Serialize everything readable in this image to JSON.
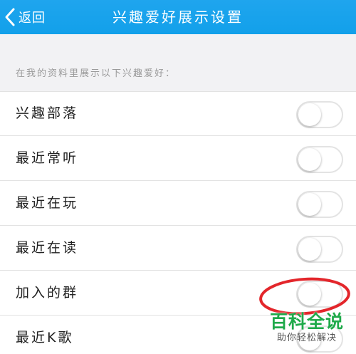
{
  "nav": {
    "back_label": "返回",
    "title": "兴趣爱好展示设置"
  },
  "section_hint": "在我的资料里展示以下兴趣爱好：",
  "settings": [
    {
      "label": "兴趣部落",
      "enabled": false
    },
    {
      "label": "最近常听",
      "enabled": false
    },
    {
      "label": "最近在玩",
      "enabled": false
    },
    {
      "label": "最近在读",
      "enabled": false
    },
    {
      "label": "加入的群",
      "enabled": false
    },
    {
      "label": "最近K歌",
      "enabled": false
    }
  ],
  "watermark": {
    "title": "百科全说",
    "subtitle": "助你轻松解决"
  },
  "colors": {
    "nav_background": "#1fa5ee",
    "highlight_ring": "#e3262b",
    "watermark_green": "#1faa4a"
  }
}
